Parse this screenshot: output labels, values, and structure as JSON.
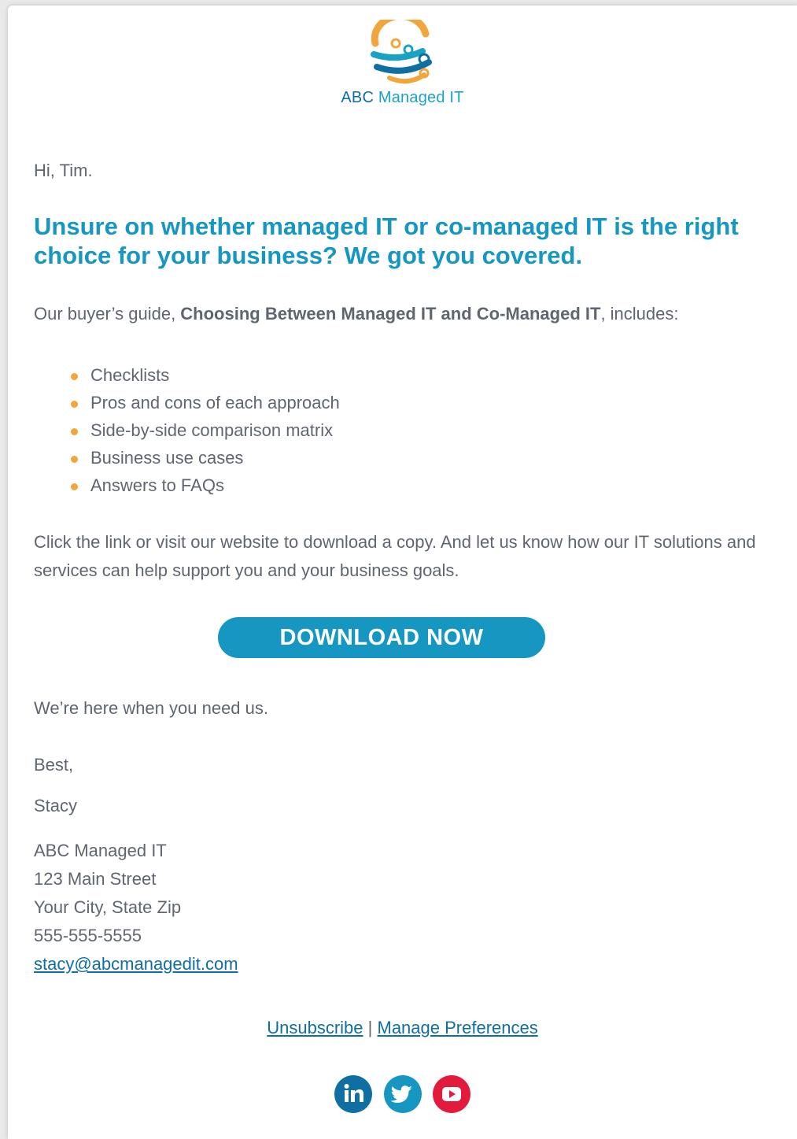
{
  "brand": {
    "name_part1": "ABC",
    "name_part2": "Managed IT",
    "colors": {
      "primary": "#1697c2",
      "dark": "#0f6fa3",
      "orange": "#f2a53a",
      "text": "#5f6670"
    }
  },
  "email": {
    "greeting": "Hi, Tim.",
    "headline": "Unsure on whether managed IT or co-managed IT is the right choice for your business? We got you covered.",
    "intro_prefix": "Our buyer’s guide, ",
    "intro_bold": "Choosing Between Managed IT and Co-Managed IT",
    "intro_suffix": ", includes:",
    "bullets": [
      "Checklists",
      "Pros and cons of each approach",
      "Side-by-side comparison matrix",
      "Business use cases",
      "Answers to FAQs"
    ],
    "cta_text": "Click the link or visit our website to download a copy. And let us know how our IT solutions and services can help support you and your business goals.",
    "button_label": "DOWNLOAD NOW",
    "closing": "We’re here when you need us.",
    "signoff": "Best,",
    "signature": "Stacy",
    "address": {
      "company": "ABC Managed IT",
      "street": "123 Main Street",
      "city": "Your City, State Zip",
      "phone": "555-555-5555",
      "email": "stacy@abcmanagedit.com"
    }
  },
  "footer": {
    "unsubscribe": "Unsubscribe",
    "separator": "|",
    "manage": "Manage Preferences",
    "social": [
      {
        "name": "linkedin-icon",
        "color": "#0f6fa3",
        "glyph": "in"
      },
      {
        "name": "twitter-icon",
        "color": "#1697c2"
      },
      {
        "name": "youtube-icon",
        "color": "#e21b3c"
      }
    ]
  }
}
